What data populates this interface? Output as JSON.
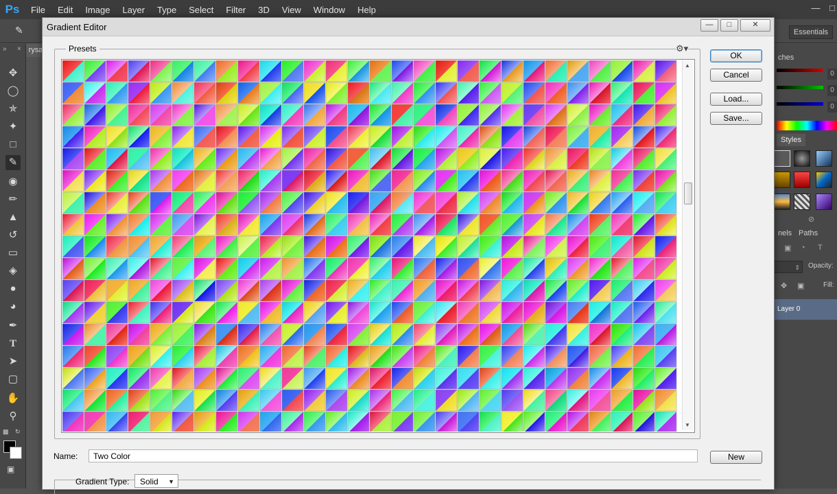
{
  "app": {
    "logo": "Ps",
    "menu": [
      "File",
      "Edit",
      "Image",
      "Layer",
      "Type",
      "Select",
      "Filter",
      "3D",
      "View",
      "Window",
      "Help"
    ],
    "workspace": "Essentials",
    "doc_tab": "rysa"
  },
  "right_panel": {
    "tab_swatches": "ches",
    "tab_styles": "Styles",
    "tab_channels": "nels",
    "tab_paths": "Paths",
    "opacity_label": "Opacity:",
    "fill_label": "Fill:",
    "slider_values": [
      "0",
      "0",
      "0"
    ],
    "layer_name": "Layer 0"
  },
  "dialog": {
    "title": "Gradient Editor",
    "presets_label": "Presets",
    "buttons": {
      "ok": "OK",
      "cancel": "Cancel",
      "load": "Load...",
      "save": "Save...",
      "new": "New"
    },
    "name_label": "Name:",
    "name_value": "Two Color",
    "gradient_type_label": "Gradient Type:",
    "gradient_type_value": "Solid",
    "preset_grid": {
      "columns": 28,
      "rows": 17
    }
  }
}
